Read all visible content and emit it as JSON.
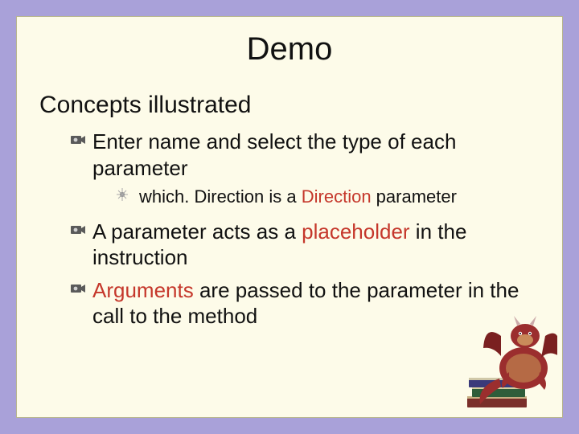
{
  "title": "Demo",
  "subtitle": "Concepts illustrated",
  "bullets": [
    {
      "text": "Enter name and select the type of each parameter",
      "children": [
        {
          "prefix": "which. Direction is a ",
          "highlight_prefix": "Direction",
          "suffix": " parameter"
        }
      ]
    },
    {
      "text_a": "A parameter acts as a ",
      "highlight": "placeholder",
      "text_b": " in the instruction"
    },
    {
      "text_a": "",
      "highlight": "Arguments",
      "text_b": " are passed to the parameter in the call to the method"
    }
  ]
}
